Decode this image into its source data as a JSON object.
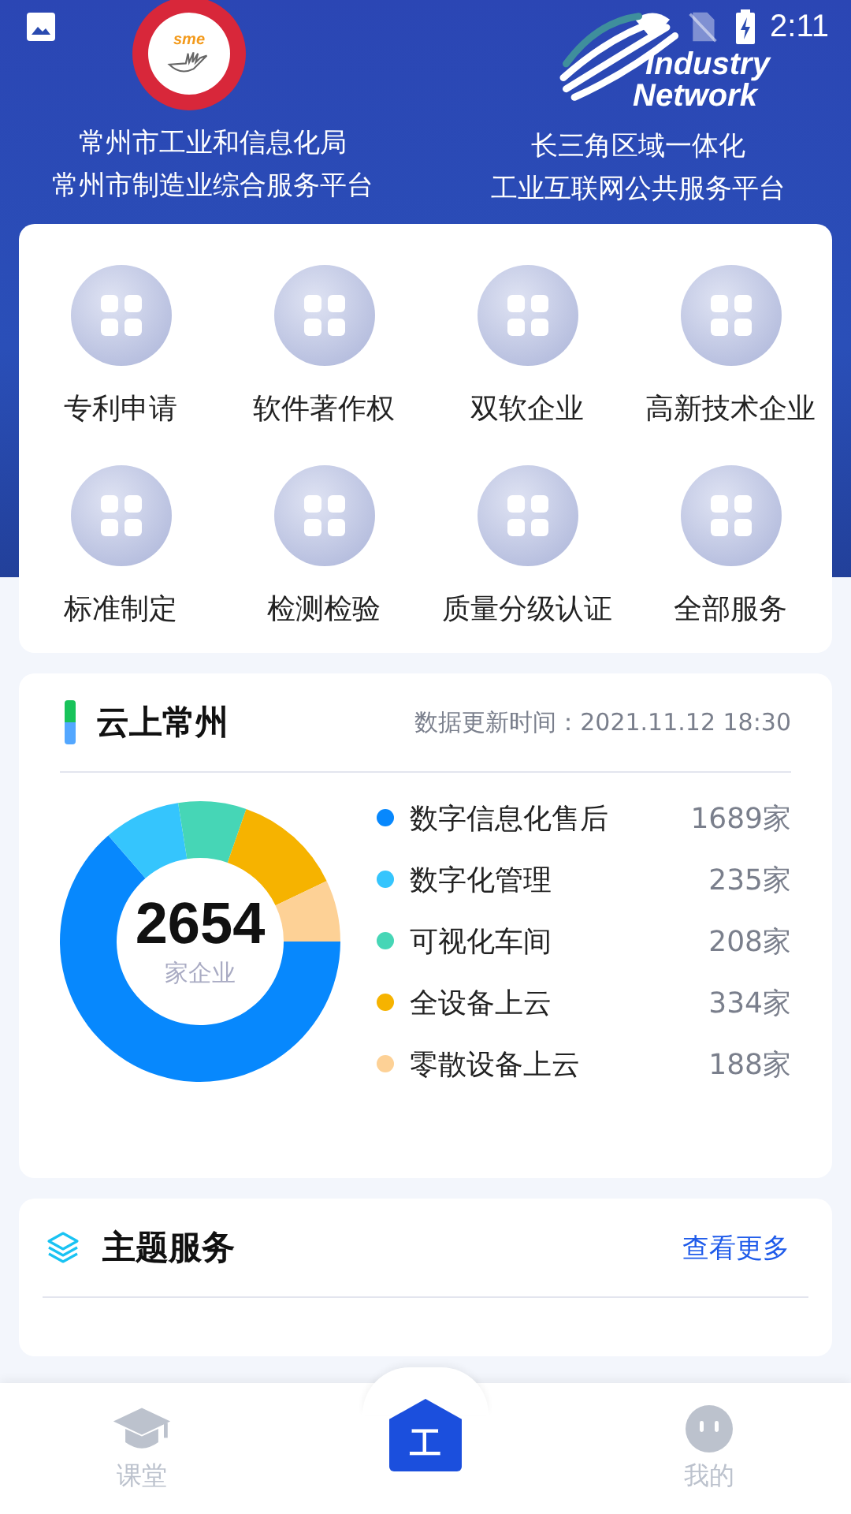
{
  "status_bar": {
    "time": "2:11"
  },
  "header": {
    "logos": [
      {
        "kind": "sme",
        "text": "sme"
      },
      {
        "kind": "network",
        "lines": [
          "Industry",
          "Network"
        ]
      }
    ],
    "titles": [
      {
        "lines": [
          "常州市工业和信息化局",
          "常州市制造业综合服务平台"
        ]
      },
      {
        "lines": [
          "长三角区域一体化",
          "工业互联网公共服务平台"
        ]
      }
    ]
  },
  "services": [
    {
      "label": "专利申请"
    },
    {
      "label": "软件著作权"
    },
    {
      "label": "双软企业"
    },
    {
      "label": "高新技术企业"
    },
    {
      "label": "标准制定"
    },
    {
      "label": "检测检验"
    },
    {
      "label": "质量分级认证"
    },
    {
      "label": "全部服务"
    }
  ],
  "cloud": {
    "title": "云上常州",
    "updated": "数据更新时间：2021.11.12 18:30",
    "total": "2654",
    "total_unit": "家企业",
    "legend": [
      {
        "count": "1689家",
        "color": "#0788fd"
      },
      {
        "count": "235家",
        "color": "#35c5fd"
      },
      {
        "count": "208家",
        "color": "#46d6b6"
      },
      {
        "count": "334家",
        "color": "#f6b300"
      },
      {
        "count": "188家",
        "color": "#fdd196"
      }
    ],
    "chart_data": {
      "type": "donut",
      "categories": [
        "数字信息化售后",
        "数字化管理",
        "可视化车间",
        "全设备上云",
        "零散设备上云"
      ],
      "values": [
        63.64,
        8.85,
        7.84,
        12.58,
        7.09
      ]
    }
  },
  "topics": {
    "title": "主题服务",
    "more": "查看更多"
  },
  "tabbar": [
    {
      "kind": "class",
      "label": "课堂",
      "selected": false
    },
    {
      "kind": "work",
      "label": "工",
      "selected": true
    },
    {
      "kind": "me",
      "label": "我的",
      "selected": false
    }
  ]
}
